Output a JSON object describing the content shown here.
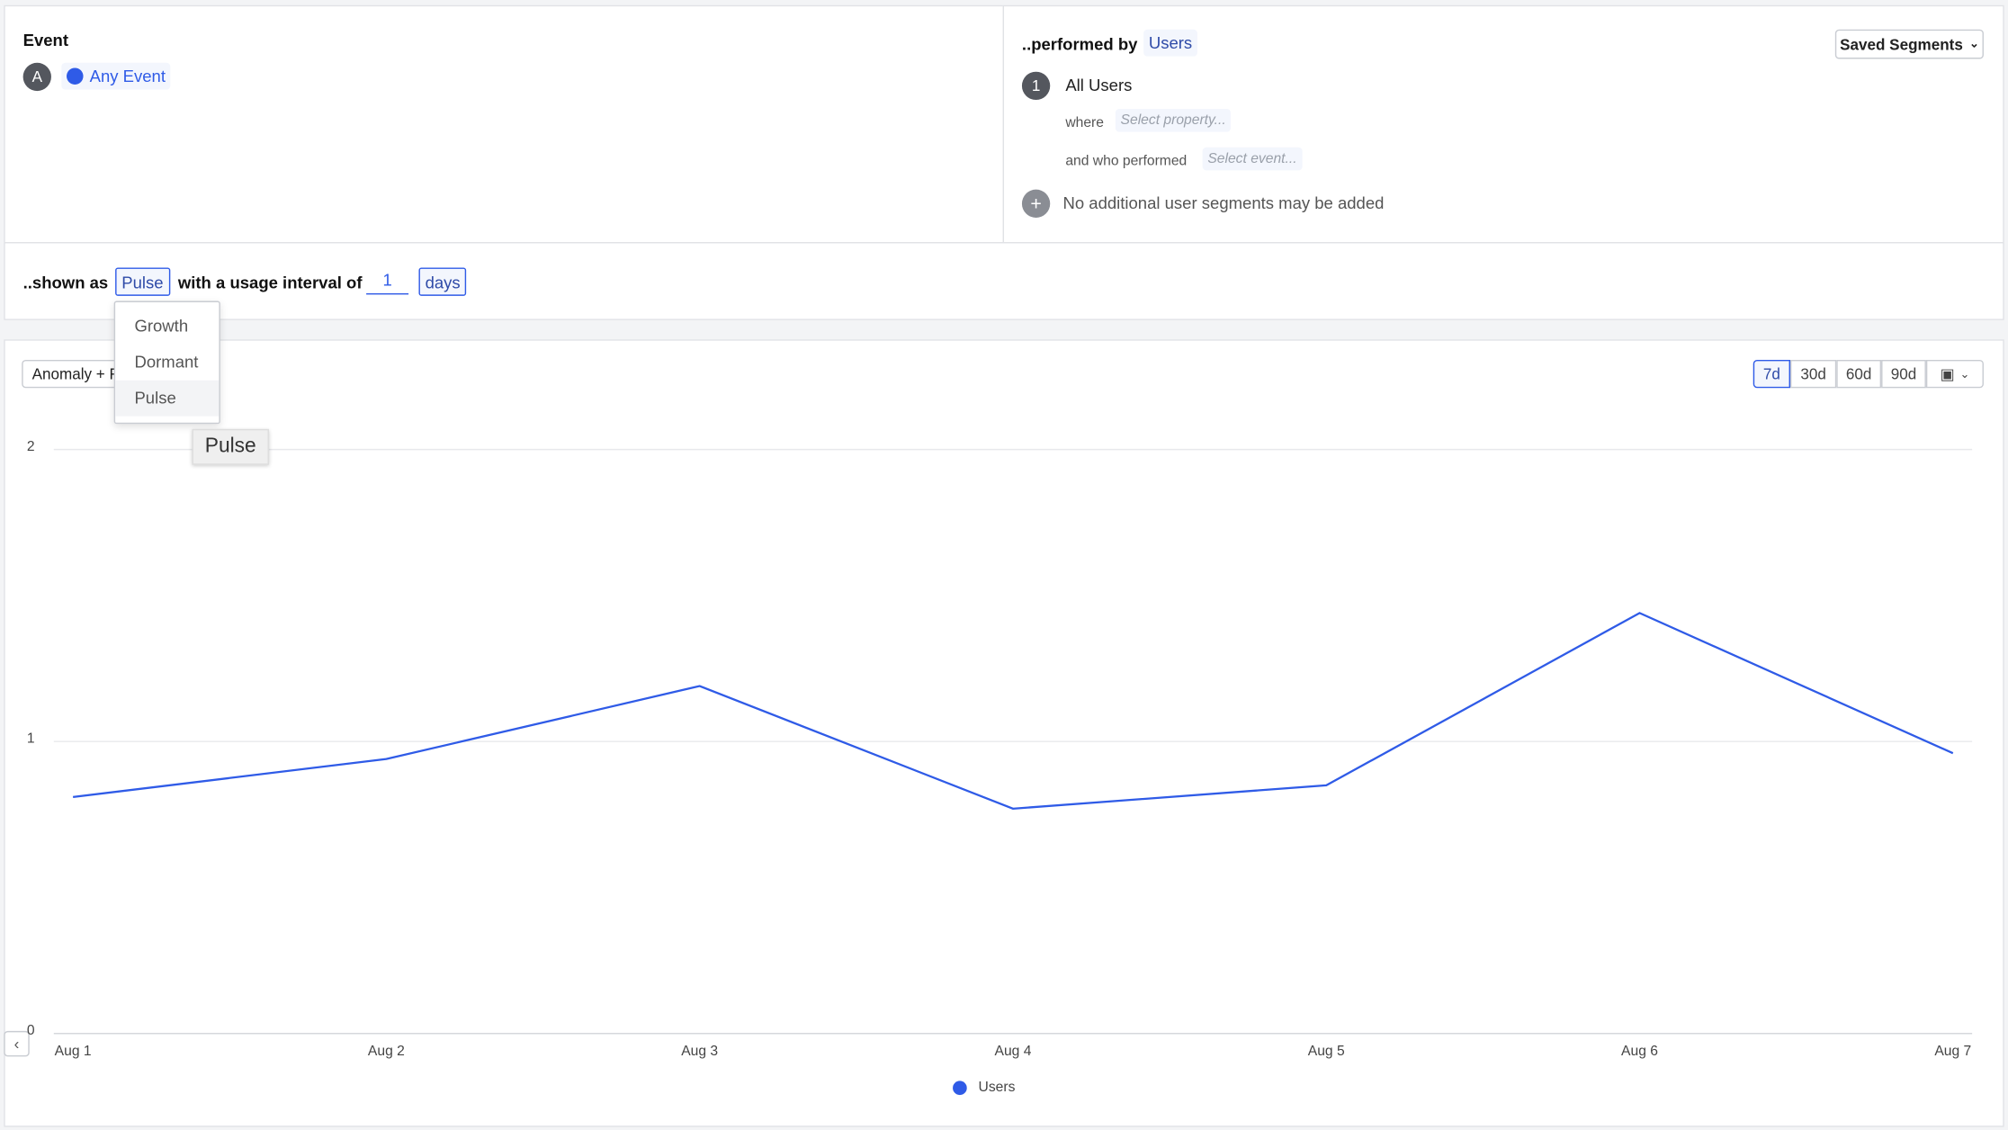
{
  "event": {
    "heading": "Event",
    "badge": "A",
    "event_label": "Any Event"
  },
  "performed_by": {
    "prefix": "..performed by",
    "entity": "Users",
    "saved_segments": "Saved Segments",
    "segment_number": "1",
    "segment_name": "All Users",
    "where_label": "where",
    "where_placeholder": "Select property...",
    "who_label": "and who performed",
    "who_placeholder": "Select event...",
    "add_note": "No additional user segments may be added"
  },
  "shown_as": {
    "prefix": "..shown as",
    "mode": "Pulse",
    "middle": "with a usage interval of",
    "interval": "1",
    "unit": "days"
  },
  "dropdown": {
    "options": [
      "Growth",
      "Dormant",
      "Pulse"
    ],
    "selected": "Pulse",
    "tooltip": "Pulse"
  },
  "chart_controls": {
    "analysis": "Anomaly + Fo",
    "ranges": [
      "7d",
      "30d",
      "60d",
      "90d"
    ],
    "active_range": "7d",
    "calendar_icon": "calendar-icon"
  },
  "colors": {
    "accent": "#2f5be7",
    "line": "#2f5be7"
  },
  "chart_data": {
    "type": "line",
    "categories": [
      "Aug 1",
      "Aug 2",
      "Aug 3",
      "Aug 4",
      "Aug 5",
      "Aug 6",
      "Aug 7"
    ],
    "series": [
      {
        "name": "Users",
        "values": [
          0.81,
          0.94,
          1.19,
          0.77,
          0.85,
          1.44,
          0.96
        ]
      }
    ],
    "yticks": [
      "0",
      "1",
      "2"
    ],
    "ylim": [
      0,
      2
    ],
    "grid": true,
    "legend": "bottom"
  }
}
